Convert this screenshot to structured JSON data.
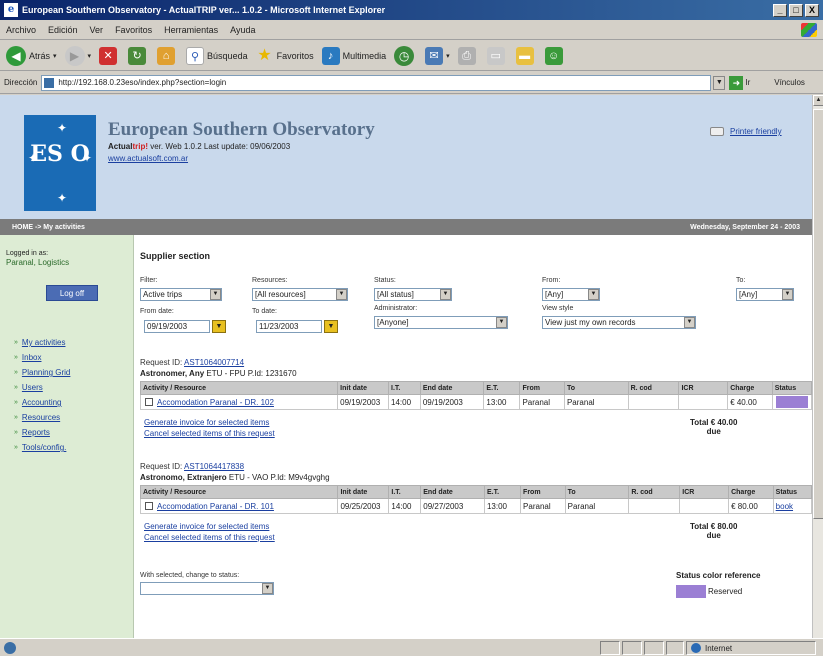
{
  "window": {
    "title": "European Southern Observatory - ActualTRIP ver... 1.0.2 - Microsoft Internet Explorer",
    "minimize": "_",
    "maximize": "□",
    "close": "X"
  },
  "menu": [
    "Archivo",
    "Edición",
    "Ver",
    "Favoritos",
    "Herramientas",
    "Ayuda"
  ],
  "toolbar": {
    "back": "Atrás",
    "search": "Búsqueda",
    "favorites": "Favoritos",
    "multimedia": "Multimedia"
  },
  "address": {
    "label": "Dirección",
    "url": "http://192.168.0.23eso/index.php?section=login",
    "go": "Ir",
    "links": "Vínculos"
  },
  "header": {
    "org_name": "European Southern Observatory",
    "app_name_1": "Actual",
    "app_name_2": "trip!",
    "version_text": " ver. Web 1.0.2 Last update: 09/06/2003",
    "site_url": "www.actualsoft.com.ar",
    "printer_link": "Printer friendly",
    "logo_letters": "ES O"
  },
  "navbar": {
    "breadcrumb": "HOME -> My activities",
    "date": "Wednesday, September 24 - 2003"
  },
  "sidebar": {
    "logged_label": "Logged in as:",
    "logged_user": "Paranal, Logistics",
    "logoff": "Log off",
    "items": [
      {
        "label": "My activities"
      },
      {
        "label": "Inbox"
      },
      {
        "label": "Planning Grid"
      },
      {
        "label": "Users"
      },
      {
        "label": "Accounting"
      },
      {
        "label": "Resources"
      },
      {
        "label": "Reports"
      },
      {
        "label": "Tools/config."
      }
    ]
  },
  "content": {
    "section_title": "Supplier section",
    "filters": {
      "filter_label": "Filter:",
      "filter_value": "Active trips",
      "resources_label": "Resources:",
      "resources_value": "[All resources]",
      "status_label": "Status:",
      "status_value": "[All status]",
      "from_label": "From:",
      "from_value": "[Any]",
      "to_label": "To:",
      "to_value": "[Any]",
      "from_date_label": "From date:",
      "from_date_value": "09/19/2003",
      "to_date_label": "To date:",
      "to_date_value": "11/23/2003",
      "administrator_label": "Administrator:",
      "administrator_value": "[Anyone]",
      "view_style_label": "View style",
      "view_style_value": "View just my own records"
    },
    "columns": [
      "Activity / Resource",
      "Init date",
      "I.T.",
      "End date",
      "E.T.",
      "From",
      "To",
      "R. cod",
      "ICR",
      "Charge",
      "Status"
    ],
    "requests": [
      {
        "id_label": "Request ID:",
        "id": "AST1064007714",
        "name": "Astronomer, Any",
        "detail": " ETU - FPU P.Id: 1231670",
        "row": {
          "activity": "Accomodation Paranal - DR. 102",
          "init_date": "09/19/2003",
          "it": "14:00",
          "end_date": "09/19/2003",
          "et": "13:00",
          "from": "Paranal",
          "to": "Paranal",
          "rcod": "",
          "icr": "",
          "charge": "€ 40.00",
          "status": ""
        },
        "gen_invoice": "Generate invoice for selected items",
        "cancel": "Cancel selected items of this request",
        "total_1": "Total € 40.00",
        "total_2": "due"
      },
      {
        "id_label": "Request ID:",
        "id": "AST1064417838",
        "name": "Astronomo, Extranjero",
        "detail": " ETU - VAO P.Id: M9v4gvghg",
        "row": {
          "activity": "Accomodation Paranal - DR. 101",
          "init_date": "09/25/2003",
          "it": "14:00",
          "end_date": "09/27/2003",
          "et": "13:00",
          "from": "Paranal",
          "to": "Paranal",
          "rcod": "",
          "icr": "",
          "charge": "€ 80.00",
          "status": "book"
        },
        "gen_invoice": "Generate invoice for selected items",
        "cancel": "Cancel selected items of this request",
        "total_1": "Total € 80.00",
        "total_2": "due"
      }
    ],
    "with_selected_label": "With selected, change to status:",
    "with_selected_value": "",
    "status_ref_title": "Status color reference",
    "status_ref_reserved": "Reserved"
  },
  "statusbar": {
    "zone": "Internet"
  },
  "colors": {
    "reserved": "#9b7fd4",
    "header_bg": "#c9d9ec",
    "sidebar_bg": "#ddecd4",
    "logo_bg": "#1a6bb5"
  }
}
